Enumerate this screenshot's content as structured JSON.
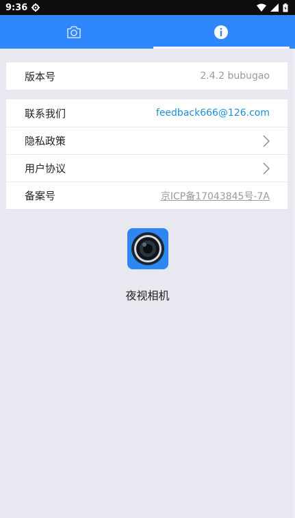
{
  "status_bar": {
    "time": "9:36"
  },
  "tabs": [
    {
      "name": "camera",
      "icon": "camera-icon",
      "active": false
    },
    {
      "name": "about",
      "icon": "info-icon",
      "active": true
    }
  ],
  "version": {
    "label": "版本号",
    "value": "2.4.2  bubugao"
  },
  "list": {
    "contact": {
      "label": "联系我们",
      "value": "feedback666@126.com"
    },
    "privacy": {
      "label": "隐私政策"
    },
    "agreement": {
      "label": "用户协议"
    },
    "icp": {
      "label": "备案号",
      "value": "京ICP备17043845号-7A"
    }
  },
  "app": {
    "name": "夜视相机"
  },
  "colors": {
    "accent": "#2f88fb",
    "link": "#1a8fd6",
    "background": "#e8e8f0"
  }
}
